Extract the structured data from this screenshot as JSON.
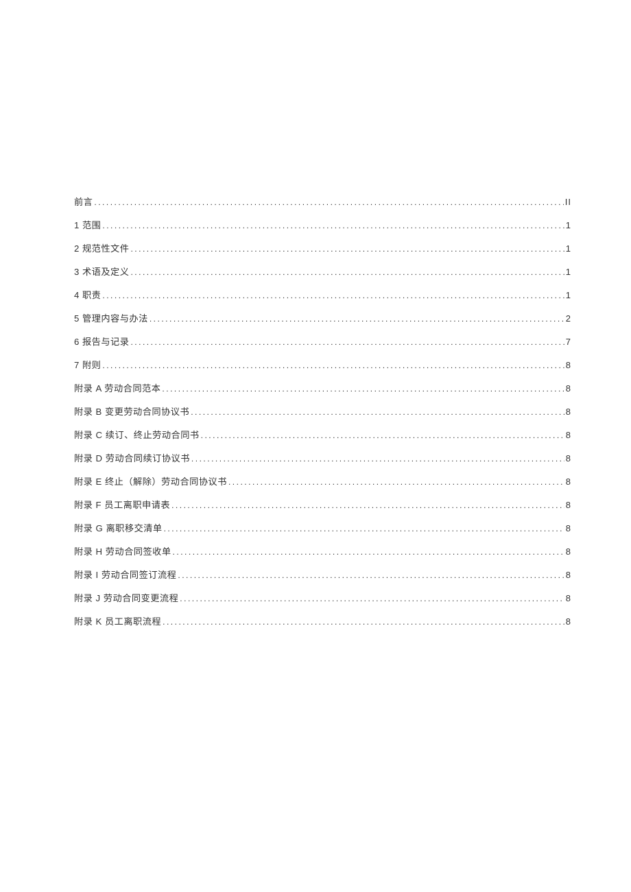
{
  "toc": {
    "entries": [
      {
        "label": "前言",
        "page": "II"
      },
      {
        "label": "1 范围",
        "page": "1"
      },
      {
        "label": "2 规范性文件",
        "page": "1"
      },
      {
        "label": "3 术语及定义",
        "page": "1"
      },
      {
        "label": "4 职责",
        "page": "1"
      },
      {
        "label": "5 管理内容与办法",
        "page": "2"
      },
      {
        "label": "6 报告与记录",
        "page": "7"
      },
      {
        "label": "7 附则",
        "page": "8"
      },
      {
        "label": "附录 A 劳动合同范本",
        "page": "8"
      },
      {
        "label": "附录 B 变更劳动合同协议书",
        "page": "8"
      },
      {
        "label": "附录 C 续订、终止劳动合同书",
        "page": "8"
      },
      {
        "label": "附录 D 劳动合同续订协议书",
        "page": "8"
      },
      {
        "label": "附录 E 终止（解除）劳动合同协议书",
        "page": "8"
      },
      {
        "label": "附录 F 员工离职申请表",
        "page": "8"
      },
      {
        "label": "附录 G 离职移交清单",
        "page": "8"
      },
      {
        "label": "附录 H 劳动合同签收单",
        "page": "8"
      },
      {
        "label": "附录 I 劳动合同签订流程",
        "page": "8"
      },
      {
        "label": "附录 J 劳动合同变更流程",
        "page": "8"
      },
      {
        "label": "附录 K 员工离职流程",
        "page": "8"
      }
    ]
  }
}
